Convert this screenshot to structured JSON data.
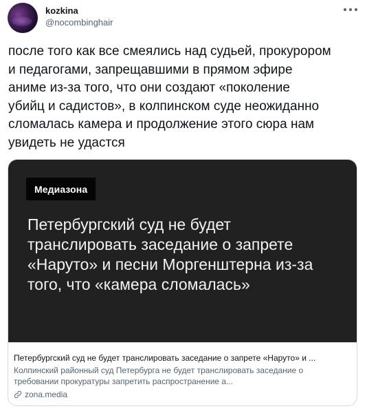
{
  "tweet": {
    "display_name": "kozkina",
    "handle": "@nocombinghair",
    "text": "после того как все смеялись над судьей, прокурором\nи педагогами, запрещавшими в прямом эфире\nаниме из-за того, что они создают «поколение\nубийц и садистов», в колпинском суде неожиданно\nсломалась камера и продолжение этого сюра нам\nувидеть не удастся"
  },
  "card": {
    "brand": "Медиазона",
    "headline": "Петербургский суд не будет\nтранслировать заседание о запрете\n«Наруто» и песни Моргенштерна из-за\nтого, что «камера сломалась»",
    "title": "Петербургский суд не будет транслировать заседание о запрете «Наруто» и ...",
    "description": "Колпинский районный суд Петербурга не будет транслировать заседание о\nтребовании прокуратуры запретить распространение а...",
    "domain": "zona.media"
  },
  "icons": {
    "more": "more-horizontal-icon",
    "link": "link-icon"
  },
  "colors": {
    "text_primary": "#0f1419",
    "text_secondary": "#536471",
    "card_image_bg": "#212121",
    "brand_bg": "#050505",
    "border": "#cfd9de"
  }
}
